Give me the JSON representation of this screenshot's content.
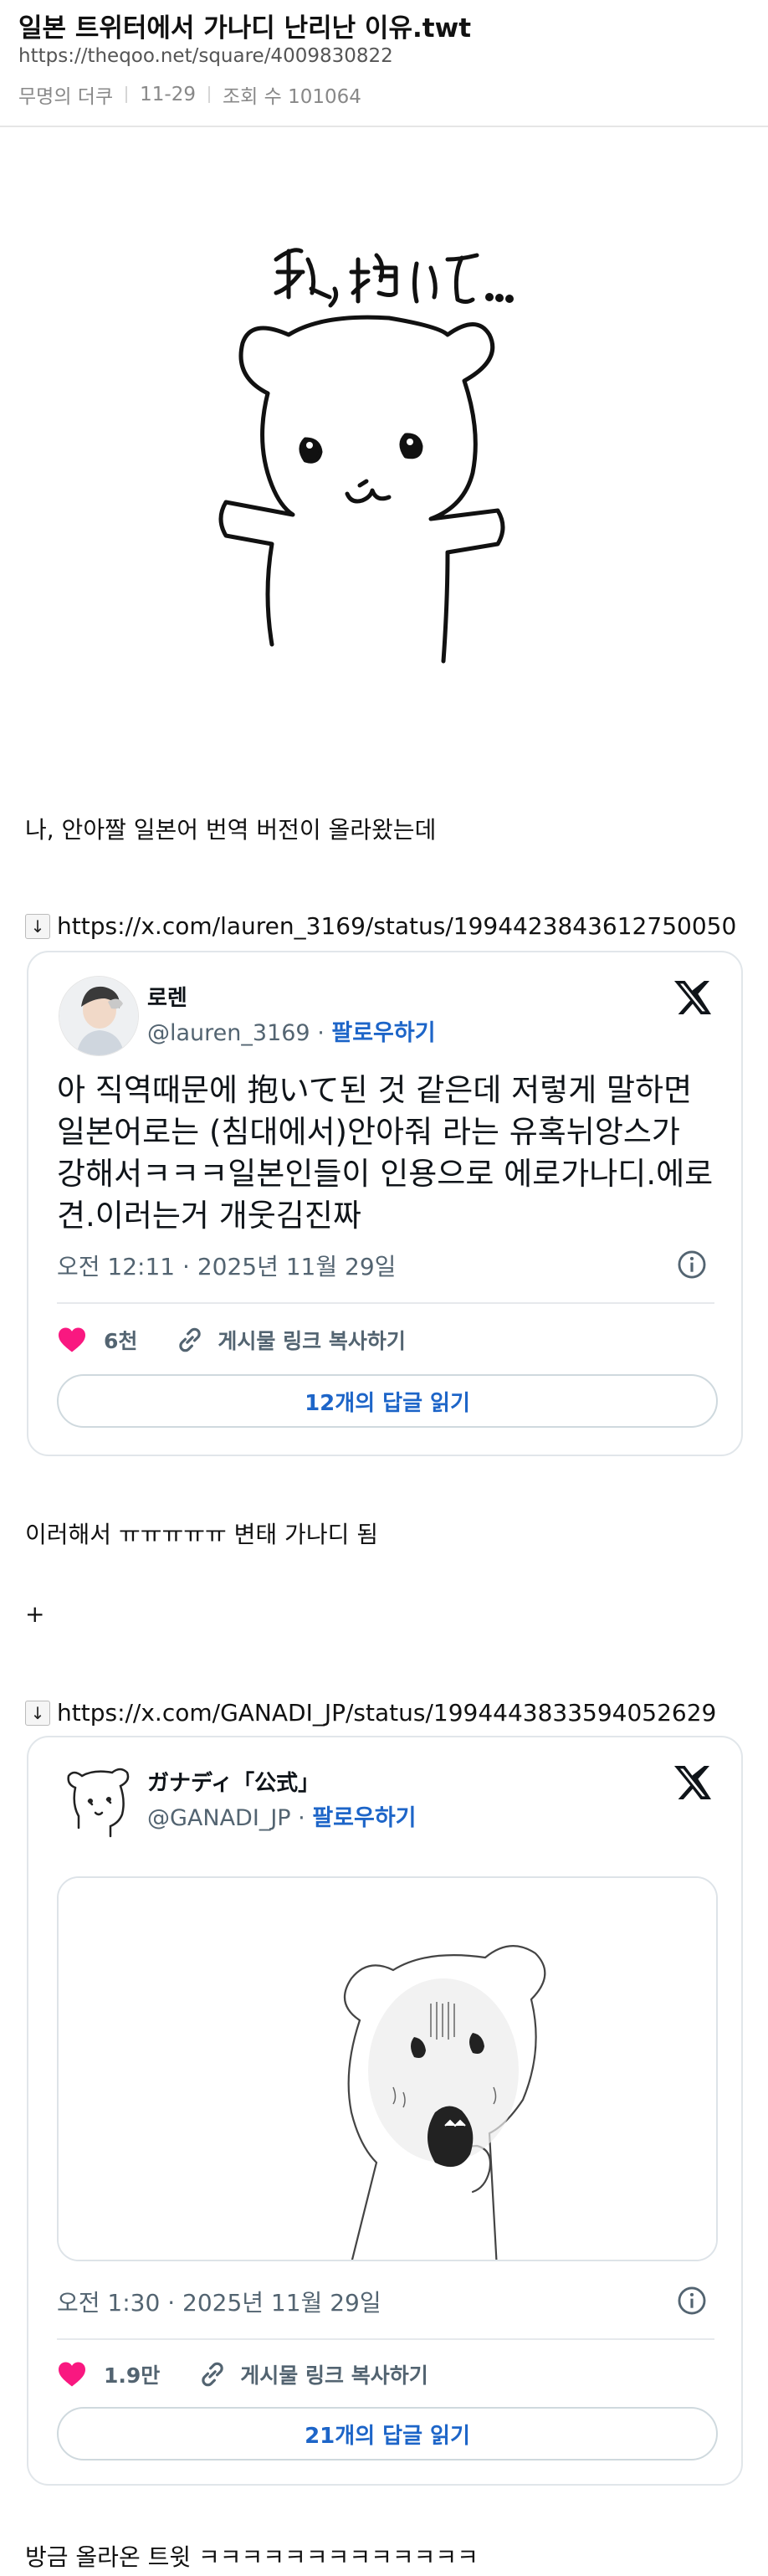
{
  "post": {
    "title": "일본 트위터에서 가나디 난리난 이유.twt",
    "url": "https://theqoo.net/square/4009830822",
    "author": "무명의 더쿠",
    "date": "11-29",
    "views": "조회 수 101064"
  },
  "image_1": {
    "handwriting": "私, 抱いて..."
  },
  "texts": {
    "intro": "나, 안아짤 일본어 번역 버전이 올라왔는데",
    "after_tweet_1": "이러해서 ㅠㅠㅠㅠㅠ 변태 가나디 됨",
    "plus": "+",
    "closing": "방금 올라온 트윗 ㅋㅋㅋㅋㅋㅋㅋㅋㅋㅋㅋㅋㅋ"
  },
  "link_1": {
    "arrow": "↓",
    "url": "https://x.com/lauren_3169/status/1994423843612750050"
  },
  "link_2": {
    "arrow": "↓",
    "url": "https://x.com/GANADI_JP/status/1994443833594052629"
  },
  "tweet_1": {
    "name": "로렌",
    "handle": "@lauren_3169",
    "separator": " · ",
    "follow": "팔로우하기",
    "text": "아 직역때문에 抱いて된 것 같은데 저렇게 말하면 일본어로는 (침대에서)안아줘 라는 유혹뉘앙스가 강해서ㅋㅋㅋ일본인들이 인용으로 에로가나디.에로견.이러는거 개웃김진짜",
    "time": "오전 12:11 · 2025년 11월 29일",
    "likes": "6천",
    "copy_link": "게시물 링크 복사하기",
    "replies": "12개의 답글 읽기"
  },
  "tweet_2": {
    "name": "ガナディ「公式」",
    "handle": "@GANADI_JP",
    "separator": " · ",
    "follow": "팔로우하기",
    "time": "오전 1:30 · 2025년 11월 29일",
    "likes": "1.9만",
    "copy_link": "게시물 링크 복사하기",
    "replies": "21개의 답글 읽기"
  },
  "colors": {
    "link_blue": "#1d65c8",
    "heart": "#f91880",
    "meta_gray": "#888888"
  },
  "icons": [
    "down-arrow-icon",
    "x-logo-icon",
    "info-icon",
    "heart-icon",
    "link-icon"
  ]
}
